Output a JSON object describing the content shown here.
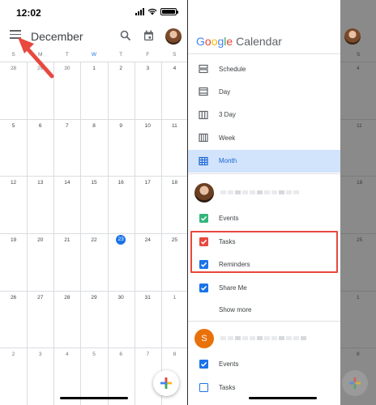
{
  "status_bar": {
    "time": "12:02"
  },
  "left_panel": {
    "month_title": "December",
    "weekdays": [
      "S",
      "M",
      "T",
      "W",
      "T",
      "F",
      "S"
    ],
    "today_col_index": 3,
    "weeks": [
      [
        "28",
        "29",
        "30",
        "1",
        "2",
        "3",
        "4"
      ],
      [
        "5",
        "6",
        "7",
        "8",
        "9",
        "10",
        "11"
      ],
      [
        "12",
        "13",
        "14",
        "15",
        "16",
        "17",
        "18"
      ],
      [
        "19",
        "20",
        "21",
        "22",
        "23",
        "24",
        "25"
      ],
      [
        "26",
        "27",
        "28",
        "29",
        "30",
        "31",
        "1"
      ],
      [
        "2",
        "3",
        "4",
        "5",
        "6",
        "7",
        "8"
      ]
    ],
    "today_date": "23",
    "annotation_arrow_color": "#e8483e"
  },
  "drawer": {
    "brand_google": "Google",
    "brand_calendar": "Calendar",
    "views": [
      {
        "label": "Schedule",
        "icon": "schedule-icon"
      },
      {
        "label": "Day",
        "icon": "day-icon"
      },
      {
        "label": "3 Day",
        "icon": "three-day-icon"
      },
      {
        "label": "Week",
        "icon": "week-icon"
      },
      {
        "label": "Month",
        "icon": "month-icon",
        "active": true
      }
    ],
    "account1_calendars": [
      {
        "label": "Events",
        "color": "#33b679",
        "checked": true
      },
      {
        "label": "Tasks",
        "color": "#e8483e",
        "checked": true
      },
      {
        "label": "Reminders",
        "color": "#1a73e8",
        "checked": true
      },
      {
        "label": "Share Me",
        "color": "#1a73e8",
        "checked": true
      }
    ],
    "show_more": "Show more",
    "account2_letter": "S",
    "account2_calendars": [
      {
        "label": "Events",
        "color": "#1a73e8",
        "checked": true
      },
      {
        "label": "Tasks",
        "color": "#1a73e8",
        "checked": false
      }
    ],
    "highlight_color": "#e8483e"
  },
  "scrim_calendar_peek": {
    "weekday": "S",
    "numbers": [
      "4",
      "11",
      "18",
      "25",
      "1",
      "8"
    ]
  },
  "colors": {
    "accent": "#1a73e8",
    "active_bg": "#d2e3fc",
    "annotation": "#e8483e"
  }
}
